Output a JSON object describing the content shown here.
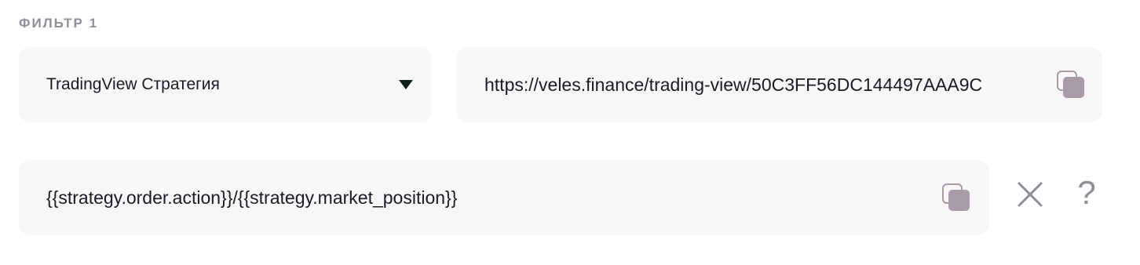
{
  "filter": {
    "label": "ФИЛЬТР 1"
  },
  "source_select": {
    "value": "TradingView Стратегия",
    "caret_icon": "caret-down-icon"
  },
  "webhook_url": {
    "value": "https://veles.finance/trading-view/50C3FF56DC144497AAA9C",
    "copy_icon": "copy-icon"
  },
  "message_template": {
    "value": "{{strategy.order.action}}/{{strategy.market_position}}",
    "copy_icon": "copy-icon"
  },
  "actions": {
    "remove_icon": "close-icon",
    "help_label": "?"
  },
  "colors": {
    "label": "#8e9097",
    "field_bg": "#f7f7f8",
    "text": "#1b1b24",
    "copy_icon": "#a89aa6",
    "action_icon": "#8d8f95"
  }
}
